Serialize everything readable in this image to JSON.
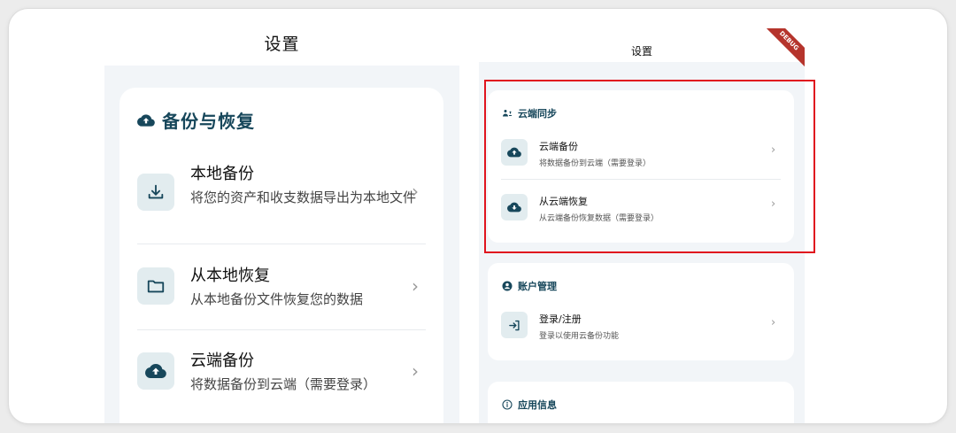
{
  "left": {
    "header_title": "设置",
    "section_title": "备份与恢复",
    "items": [
      {
        "title": "本地备份",
        "subtitle": "将您的资产和收支数据导出为本地文件",
        "icon": "download-icon"
      },
      {
        "title": "从本地恢复",
        "subtitle": "从本地备份文件恢复您的数据",
        "icon": "folder-icon"
      },
      {
        "title": "云端备份",
        "subtitle": "将数据备份到云端（需要登录）",
        "icon": "cloud-upload-icon"
      }
    ]
  },
  "right": {
    "header_title": "设置",
    "debug_label": "DEBUG",
    "sections": [
      {
        "title": "云端同步",
        "items": [
          {
            "title": "云端备份",
            "subtitle": "将数据备份到云端（需要登录）",
            "icon": "cloud-upload-icon"
          },
          {
            "title": "从云端恢复",
            "subtitle": "从云端备份恢复数据（需要登录）",
            "icon": "cloud-download-icon"
          }
        ]
      },
      {
        "title": "账户管理",
        "items": [
          {
            "title": "登录/注册",
            "subtitle": "登录以使用云备份功能",
            "icon": "login-icon"
          }
        ]
      },
      {
        "title": "应用信息",
        "items": []
      }
    ]
  },
  "chevron": "›",
  "colors": {
    "accent": "#17475b",
    "highlight": "#e0141e",
    "icon_bg": "#e2ecef",
    "debug": "#b5342c"
  }
}
